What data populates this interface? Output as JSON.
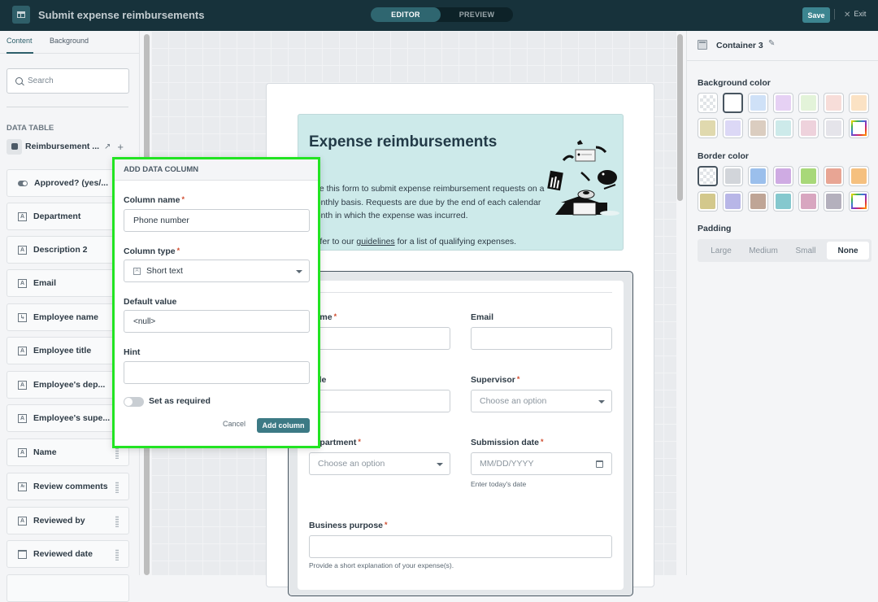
{
  "topbar": {
    "app_icon": "app-layout-icon",
    "title": "Submit expense reimbursements",
    "modes": [
      {
        "label": "EDITOR",
        "active": true
      },
      {
        "label": "PREVIEW",
        "active": false
      }
    ],
    "save_label": "Save",
    "exit_label": "Exit"
  },
  "left_panel": {
    "tabs": [
      {
        "label": "Content",
        "active": true
      },
      {
        "label": "Background",
        "active": false
      }
    ],
    "search_placeholder": "Search",
    "section_label": "DATA TABLE",
    "table_name": "Reimbursement ...",
    "columns": [
      {
        "label": "Approved? (yes/...",
        "icon": "toggle-icon"
      },
      {
        "label": "Department",
        "icon": "text-icon"
      },
      {
        "label": "Description 2",
        "icon": "text-icon"
      },
      {
        "label": "Email",
        "icon": "text-icon"
      },
      {
        "label": "Employee name",
        "icon": "user-select-icon"
      },
      {
        "label": "Employee title",
        "icon": "text-icon"
      },
      {
        "label": "Employee's dep...",
        "icon": "text-icon"
      },
      {
        "label": "Employee's supe...",
        "icon": "text-icon"
      },
      {
        "label": "Name",
        "icon": "text-icon"
      },
      {
        "label": "Review comments",
        "icon": "long-text-icon"
      },
      {
        "label": "Reviewed by",
        "icon": "text-icon"
      },
      {
        "label": "Reviewed date",
        "icon": "calendar-icon"
      }
    ]
  },
  "dialog": {
    "title": "ADD DATA COLUMN",
    "column_name_label": "Column name",
    "column_name_value": "Phone number",
    "column_type_label": "Column type",
    "column_type_value": "Short text",
    "default_value_label": "Default value",
    "default_value": "<null>",
    "hint_label": "Hint",
    "hint_value": "",
    "required_label": "Set as required",
    "required": false,
    "cancel_label": "Cancel",
    "add_label": "Add column"
  },
  "form": {
    "title": "Expense reimbursements",
    "intro": "Use this form to submit expense reimbursement requests on a monthly basis. Requests are due by the end of each calendar month in which the expense was incurred.",
    "refer_prefix": "Refer to our ",
    "refer_link": "guidelines",
    "refer_suffix": " for a list of qualifying expenses.",
    "fields": {
      "name_label": "Name",
      "email_label": "Email",
      "title_label": "Title",
      "supervisor_label": "Supervisor",
      "supervisor_placeholder": "Choose an option",
      "department_label": "Department",
      "department_placeholder": "Choose an option",
      "submission_label": "Submission date",
      "submission_placeholder": "MM/DD/YYYY",
      "submission_hint": "Enter today's date",
      "purpose_label": "Business purpose",
      "purpose_hint": "Provide a short explanation of your expense(s)."
    }
  },
  "right_panel": {
    "title": "Container 3",
    "background_label": "Background color",
    "background_colors": [
      "transparent",
      "#ffffff",
      "#cfe1f7",
      "#e6d1f4",
      "#e3f3d9",
      "#f7ddd9",
      "#fbe2c4",
      "#e0d9ae",
      "#dcd8f6",
      "#dbcdc0",
      "#cdeaea",
      "#eed2dc",
      "#e5e4ea",
      "custom"
    ],
    "background_selected": 1,
    "border_label": "Border color",
    "border_colors": [
      "transparent",
      "#d2d5da",
      "#9bbfec",
      "#cfabe3",
      "#a8d879",
      "#e8a594",
      "#f5c07f",
      "#d3c88c",
      "#b8b6e7",
      "#bfa596",
      "#85c8ce",
      "#d8a6c0",
      "#b4b0bd",
      "custom"
    ],
    "border_selected": 0,
    "padding_label": "Padding",
    "padding_options": [
      "Large",
      "Medium",
      "Small",
      "None"
    ],
    "padding_selected": "None"
  }
}
